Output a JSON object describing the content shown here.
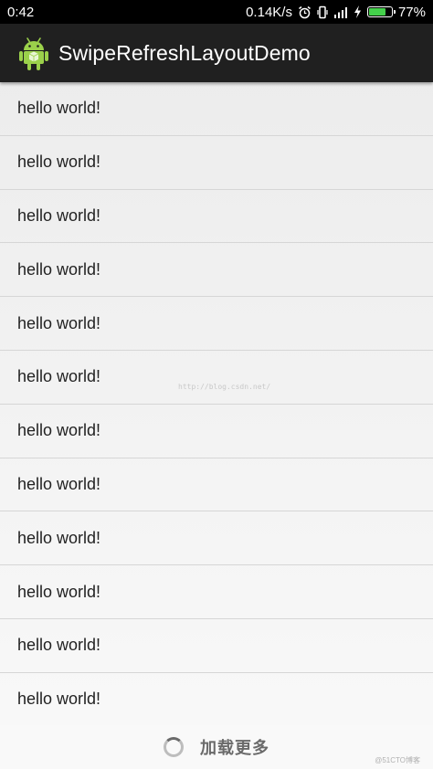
{
  "status_bar": {
    "time": "0:42",
    "net_speed": "0.14K/s",
    "battery_percent": "77%",
    "battery_level": 0.77,
    "icons": [
      "alarm-icon",
      "vibrate-icon",
      "signal-icon",
      "charging-icon",
      "battery-icon"
    ]
  },
  "action_bar": {
    "icon": "android-icon",
    "title": "SwipeRefreshLayoutDemo"
  },
  "list": {
    "items": [
      "hello world!",
      "hello world!",
      "hello world!",
      "hello world!",
      "hello world!",
      "hello world!",
      "hello world!",
      "hello world!",
      "hello world!",
      "hello world!",
      "hello world!",
      "hello world!"
    ]
  },
  "footer": {
    "label": "加载更多",
    "icon": "loading-spinner-icon"
  },
  "watermark": "http://blog.csdn.net/",
  "corner_mark": "@51CTO博客",
  "colors": {
    "status_bar_bg": "#000000",
    "action_bar_bg": "#202020",
    "battery_fill": "#44d04b"
  }
}
